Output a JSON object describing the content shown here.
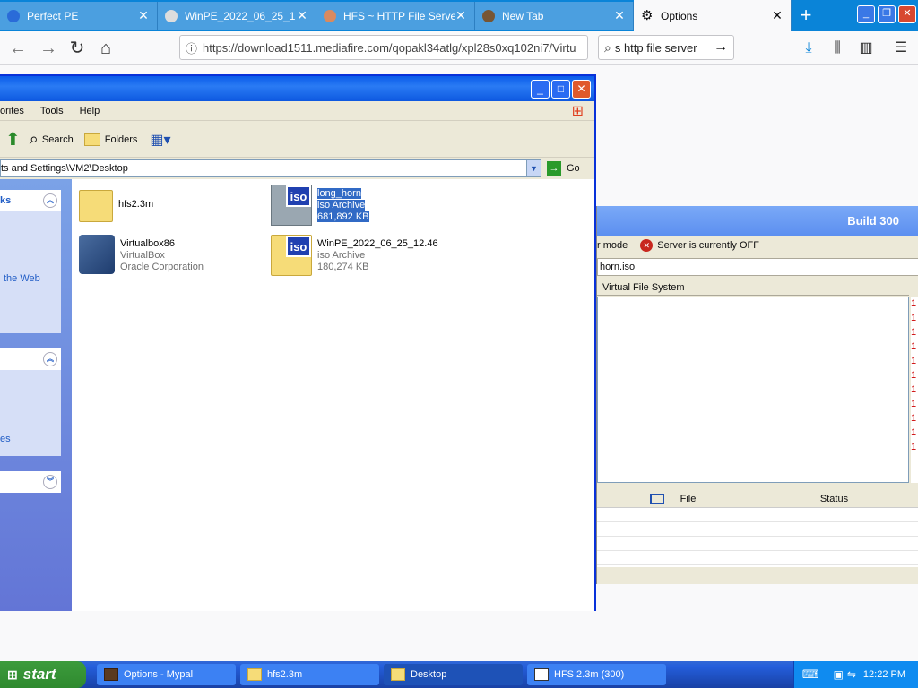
{
  "browser": {
    "tabs": [
      {
        "title": "Perfect PE",
        "icon_color": "#2a6bd8"
      },
      {
        "title": "WinPE_2022_06_25_12.46",
        "icon_color": "#dddddd"
      },
      {
        "title": "HFS ~ HTTP File Server",
        "icon_color": "#d88a60"
      },
      {
        "title": "New Tab",
        "icon_color": "#775533"
      },
      {
        "title": "Options",
        "icon_color": "#333333"
      }
    ],
    "url": "https://download1511.mediafire.com/qopakl34atlg/xpl28s0xq102ni7/Virtu",
    "search_value": "s http file server"
  },
  "hfs": {
    "build": "Build 300",
    "mode_label": "r mode",
    "server_status": "Server is currently OFF",
    "file_path": "horn.iso",
    "vfs_header": "Virtual File System",
    "log_lines": [
      "1",
      "1",
      "1",
      "1",
      "1",
      "1",
      "1",
      "1",
      "1",
      "1",
      "1"
    ],
    "columns": {
      "file": "File",
      "status": "Status"
    }
  },
  "explorer": {
    "menu": [
      "orites",
      "Tools",
      "Help"
    ],
    "toolbar": {
      "search": "Search",
      "folders": "Folders"
    },
    "address": "ts and Settings\\VM2\\Desktop",
    "go": "Go",
    "left": {
      "panel1_title": "ks",
      "panel1_item": "the Web",
      "panel2_item": "es"
    },
    "files": [
      {
        "name": "hfs2.3m",
        "line2": "",
        "line3": ""
      },
      {
        "name": "long_horn",
        "line2": "iso Archive",
        "line3": "681,892 KB"
      },
      {
        "name": "Virtualbox86",
        "line2": "VirtualBox",
        "line3": "Oracle Corporation"
      },
      {
        "name": "WinPE_2022_06_25_12.46",
        "line2": "iso Archive",
        "line3": "180,274 KB"
      }
    ],
    "iso_badge": "iso"
  },
  "taskbar": {
    "start": "start",
    "tasks": [
      "Options - Mypal",
      "hfs2.3m",
      "Desktop",
      "HFS 2.3m (300)"
    ],
    "clock": "12:22 PM"
  }
}
